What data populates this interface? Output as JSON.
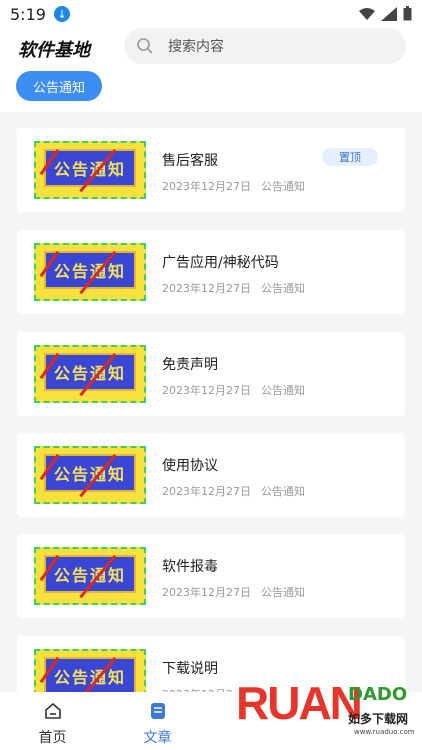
{
  "status_bar": {
    "time": "5:19"
  },
  "header": {
    "title": "软件基地",
    "search_placeholder": "搜索内容",
    "active_category": "公告通知"
  },
  "articles": [
    {
      "title": "售后客服",
      "date": "2023年12月27日",
      "category": "公告通知",
      "badge": "置顶",
      "thumb_text": "公告通知"
    },
    {
      "title": "广告应用/神秘代码",
      "date": "2023年12月27日",
      "category": "公告通知",
      "thumb_text": "公告通知"
    },
    {
      "title": "免责声明",
      "date": "2023年12月27日",
      "category": "公告通知",
      "thumb_text": "公告通知"
    },
    {
      "title": "使用协议",
      "date": "2023年12月27日",
      "category": "公告通知",
      "thumb_text": "公告通知"
    },
    {
      "title": "软件报毒",
      "date": "2023年12月27日",
      "category": "公告通知",
      "thumb_text": "公告通知"
    },
    {
      "title": "下载说明",
      "date": "2023年12月2",
      "category": "",
      "thumb_text": "公告通知"
    }
  ],
  "bottom_nav": [
    {
      "label": "首页",
      "icon": "home-icon",
      "active": false
    },
    {
      "label": "文章",
      "icon": "article-icon",
      "active": true
    }
  ],
  "watermark": {
    "brand": "RUAN",
    "brand2": "DADO",
    "cn": "如多下载网",
    "url": "www.ruaduo.com"
  },
  "colors": {
    "accent": "#3d8ef3",
    "badge_text": "#3d79d8"
  }
}
